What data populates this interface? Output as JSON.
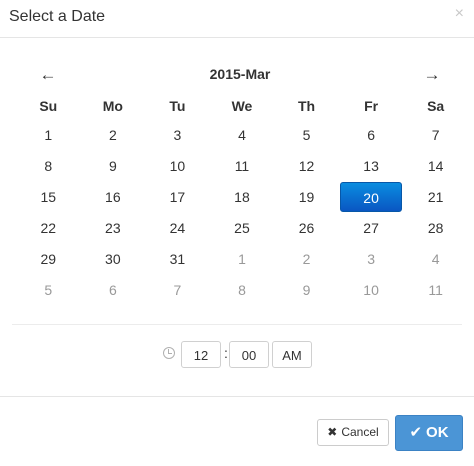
{
  "dialog": {
    "title": "Select a Date",
    "close_glyph": "×"
  },
  "calendar": {
    "prev_arrow": "🡐",
    "next_arrow": "🡒",
    "month_label": "2015-Mar",
    "weekdays": [
      "Su",
      "Mo",
      "Tu",
      "We",
      "Th",
      "Fr",
      "Sa"
    ],
    "selected_day": "20",
    "weeks": [
      [
        {
          "d": "1"
        },
        {
          "d": "2"
        },
        {
          "d": "3"
        },
        {
          "d": "4"
        },
        {
          "d": "5"
        },
        {
          "d": "6"
        },
        {
          "d": "7"
        }
      ],
      [
        {
          "d": "8"
        },
        {
          "d": "9"
        },
        {
          "d": "10"
        },
        {
          "d": "11"
        },
        {
          "d": "12"
        },
        {
          "d": "13"
        },
        {
          "d": "14"
        }
      ],
      [
        {
          "d": "15"
        },
        {
          "d": "16"
        },
        {
          "d": "17"
        },
        {
          "d": "18"
        },
        {
          "d": "19"
        },
        {
          "d": "20",
          "active": true
        },
        {
          "d": "21"
        }
      ],
      [
        {
          "d": "22"
        },
        {
          "d": "23"
        },
        {
          "d": "24"
        },
        {
          "d": "25"
        },
        {
          "d": "26"
        },
        {
          "d": "27"
        },
        {
          "d": "28"
        }
      ],
      [
        {
          "d": "29"
        },
        {
          "d": "30"
        },
        {
          "d": "31"
        },
        {
          "d": "1",
          "muted": true
        },
        {
          "d": "2",
          "muted": true
        },
        {
          "d": "3",
          "muted": true
        },
        {
          "d": "4",
          "muted": true
        }
      ],
      [
        {
          "d": "5",
          "muted": true
        },
        {
          "d": "6",
          "muted": true
        },
        {
          "d": "7",
          "muted": true
        },
        {
          "d": "8",
          "muted": true
        },
        {
          "d": "9",
          "muted": true
        },
        {
          "d": "10",
          "muted": true
        },
        {
          "d": "11",
          "muted": true
        }
      ]
    ]
  },
  "time": {
    "icon": "clock-icon",
    "hour": "12",
    "separator": ":",
    "minute": "00",
    "period": "AM"
  },
  "footer": {
    "cancel_label": "Cancel",
    "cancel_icon": "✖",
    "ok_label": "OK",
    "ok_icon": "✔"
  },
  "colors": {
    "selected_day_bg": "#0a6fd6",
    "ok_button_bg": "#4b95d6",
    "muted_day": "#999999"
  }
}
